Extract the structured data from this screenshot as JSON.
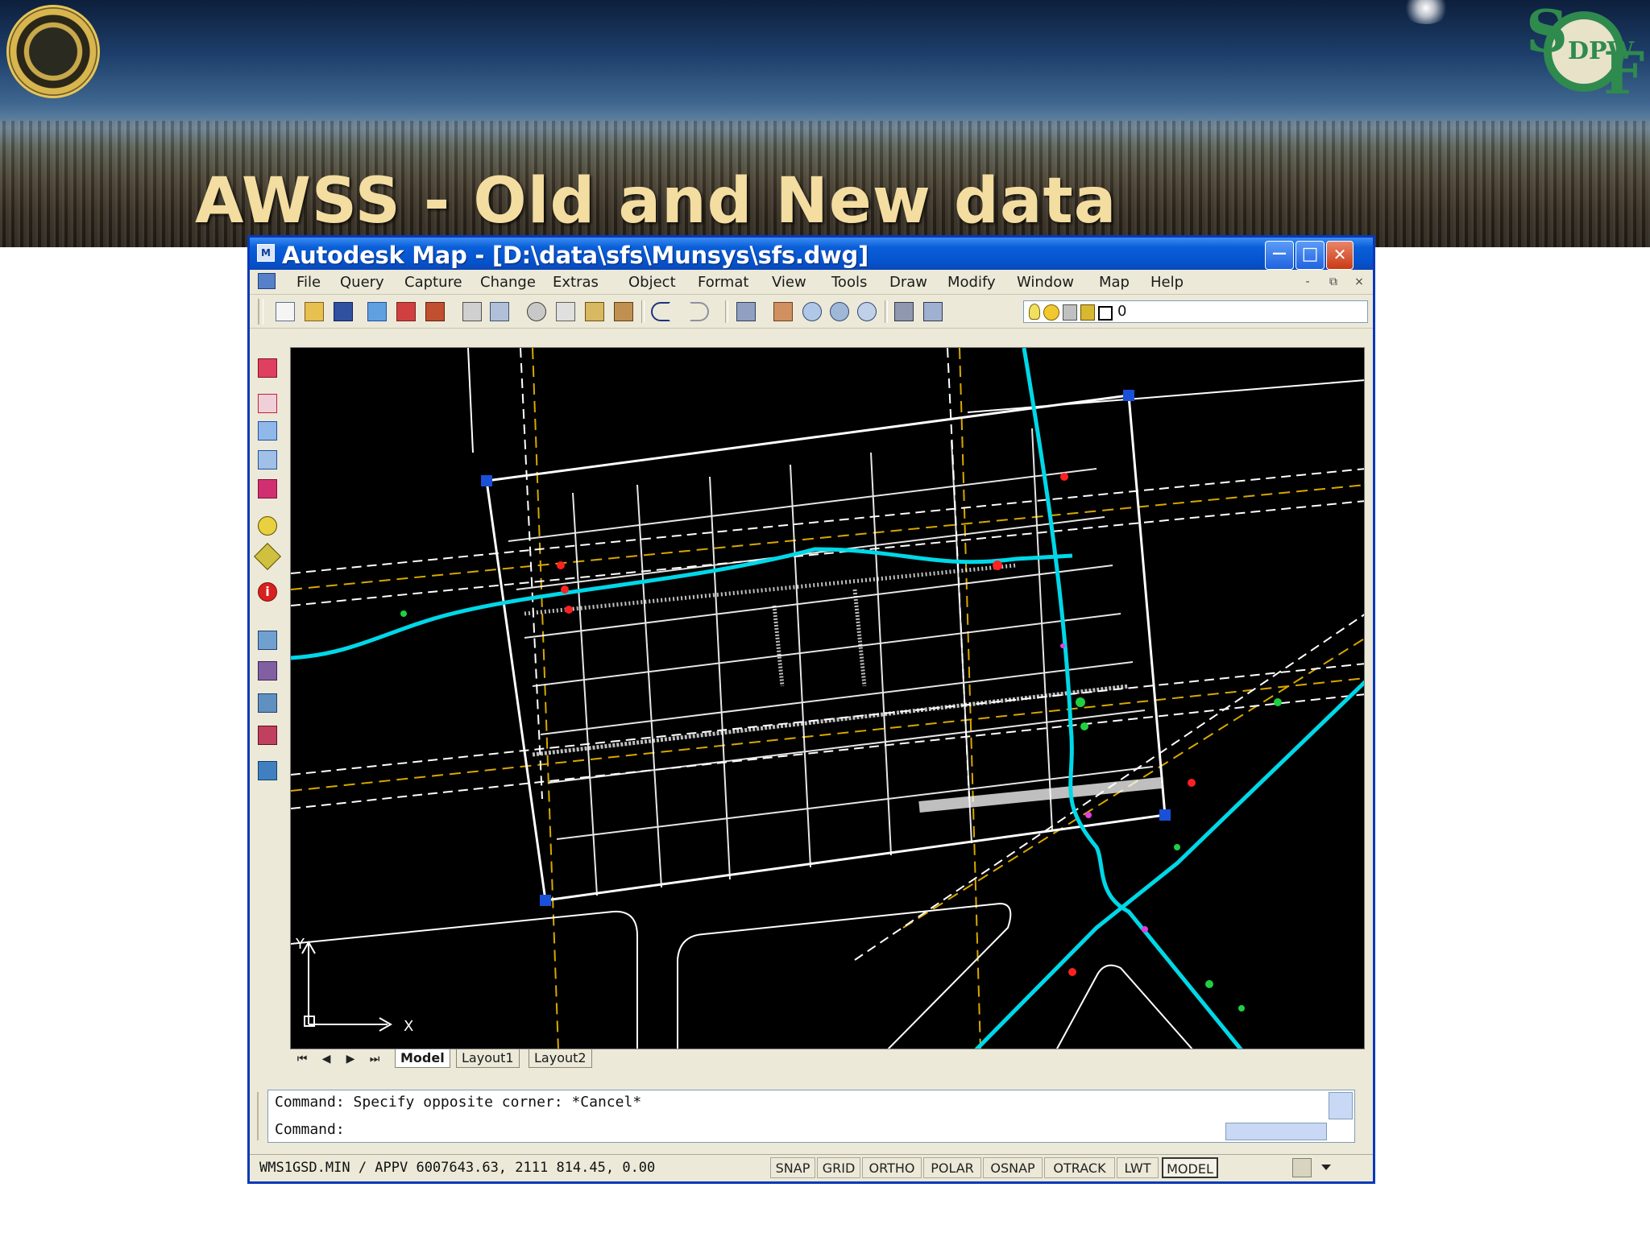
{
  "slide": {
    "title": "AWSS - Old and New data"
  },
  "window": {
    "title": "Autodesk Map - [D:\\data\\sfs\\Munsys\\sfs.dwg]",
    "app_icon_text": "M",
    "minimize_symbol": "—",
    "maximize_symbol": "□",
    "close_symbol": "✕"
  },
  "menu": {
    "items": [
      "File",
      "Query",
      "Capture",
      "Change",
      "Extras",
      "Object",
      "Format",
      "View",
      "Tools",
      "Draw",
      "Modify",
      "Window",
      "Map",
      "Help"
    ],
    "doc_min": "-",
    "doc_restore": "⧉",
    "doc_close": "×"
  },
  "layer_combo": {
    "value": "0"
  },
  "layout_tabs": {
    "arrows": [
      "⏮",
      "◀",
      "▶",
      "⏭"
    ],
    "tabs": [
      "Model",
      "Layout1",
      "Layout2"
    ]
  },
  "command": {
    "line1": "Command: Specify opposite corner: *Cancel*",
    "line2": "Command:"
  },
  "status": {
    "coords": "WMS1GSD.MIN / APPV  6007643.63, 2111 814.45, 0.00",
    "toggles": [
      "SNAP",
      "GRID",
      "ORTHO",
      "POLAR",
      "OSNAP",
      "OTRACK",
      "LWT",
      "MODEL"
    ]
  },
  "ucs": {
    "x_label": "X",
    "y_label": "Y"
  },
  "icons": {
    "toolbar": [
      "new-icon",
      "open-icon",
      "save-icon",
      "publish-icon",
      "plot-icon",
      "plot-preview-icon",
      "print-icon",
      "find-icon",
      "cut-icon",
      "copy-icon",
      "paste-icon",
      "match-properties-icon",
      "undo-icon",
      "redo-icon",
      "hyperlink-icon",
      "pan-icon",
      "zoom-realtime-icon",
      "zoom-window-icon",
      "zoom-previous-icon",
      "properties-icon",
      "design-center-icon",
      "layer-icon"
    ],
    "left": [
      "map-tool-1-icon",
      "map-tool-2-icon",
      "map-tool-3-icon",
      "map-tool-4-icon",
      "map-tool-5-icon",
      "map-tool-6-icon",
      "map-tool-7-icon",
      "info-icon",
      "map-tool-8-icon",
      "map-tool-9-icon",
      "map-tool-10-icon",
      "map-tool-11-icon",
      "map-tool-12-icon"
    ]
  },
  "colors": {
    "titlebar": "#0554d0",
    "canvas": "#000000",
    "main_pipe": "#00d8e8",
    "linework": "#ffffff",
    "road_centerline": "#d8a800",
    "grip": "#1a4fd8",
    "title_text": "#f3dda0"
  }
}
